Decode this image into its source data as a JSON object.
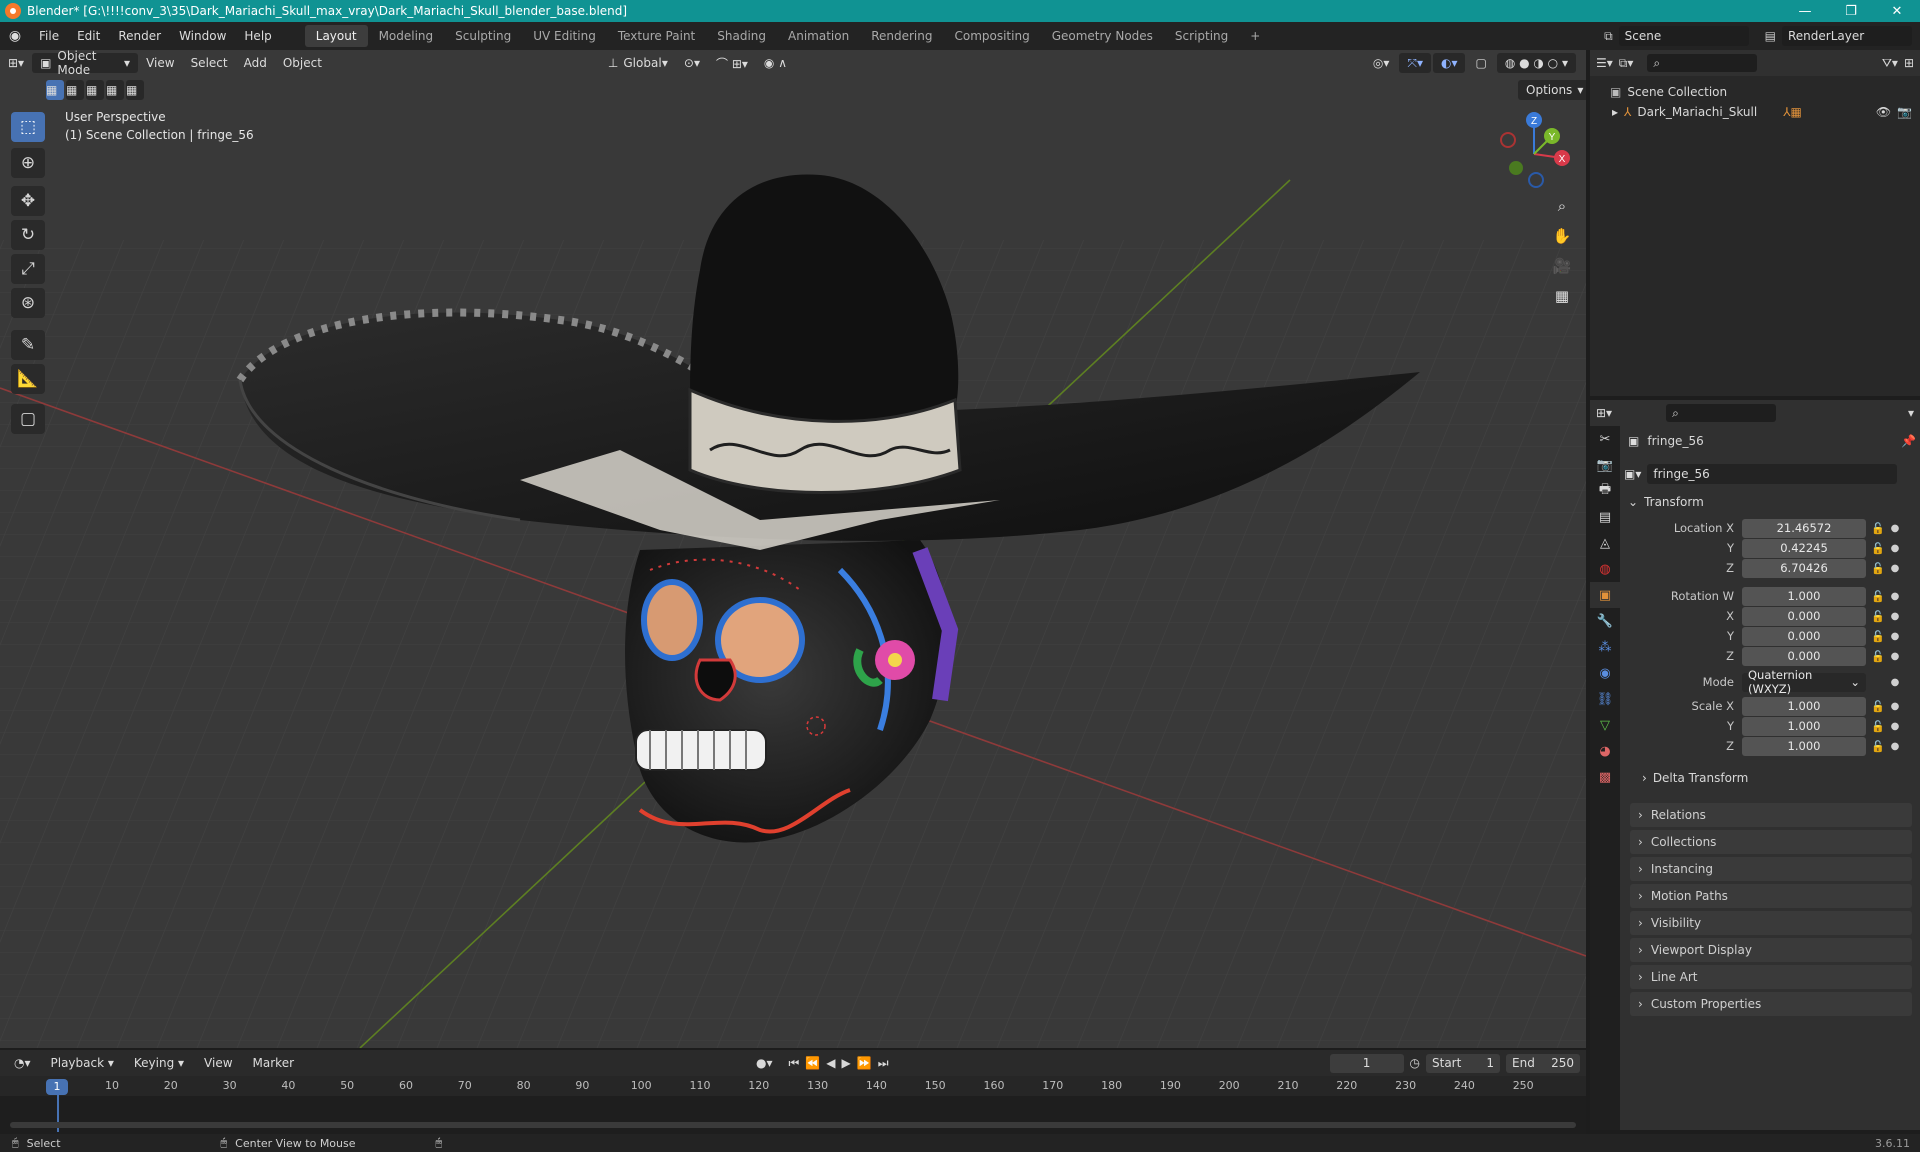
{
  "titlebar": {
    "title": "Blender* [G:\\!!!!conv_3\\35\\Dark_Mariachi_Skull_max_vray\\Dark_Mariachi_Skull_blender_base.blend]",
    "minimize": "—",
    "maximize": "❐",
    "close": "✕"
  },
  "menu": [
    "File",
    "Edit",
    "Render",
    "Window",
    "Help"
  ],
  "workspaces": [
    "Layout",
    "Modeling",
    "Sculpting",
    "UV Editing",
    "Texture Paint",
    "Shading",
    "Animation",
    "Rendering",
    "Compositing",
    "Geometry Nodes",
    "Scripting"
  ],
  "workspace_add": "+",
  "scene": {
    "name": "Scene",
    "render_layer": "RenderLayer"
  },
  "viewport": {
    "mode": "Object Mode",
    "menus": [
      "View",
      "Select",
      "Add",
      "Object"
    ],
    "orientation": "Global",
    "options": "Options",
    "perspective_label": "User Perspective",
    "collection_label": "(1) Scene Collection | fringe_56",
    "gizmo": {
      "x": "X",
      "y": "Y",
      "z": "Z"
    }
  },
  "outliner": {
    "scene_collection": "Scene Collection",
    "object": "Dark_Mariachi_Skull"
  },
  "properties": {
    "object_name": "fringe_56",
    "datablock": "fringe_56",
    "transform_header": "Transform",
    "location": {
      "label": "Location X",
      "x": "21.46572",
      "y": "0.42245",
      "z": "6.70426"
    },
    "rotation": {
      "label": "Rotation W",
      "w": "1.000",
      "x": "0.000",
      "y": "0.000",
      "z": "0.000"
    },
    "mode": {
      "label": "Mode",
      "value": "Quaternion (WXYZ)"
    },
    "scale": {
      "label": "Scale X",
      "x": "1.000",
      "y": "1.000",
      "z": "1.000"
    },
    "axis_labels": {
      "y": "Y",
      "z": "Z",
      "x": "X"
    },
    "delta": "Delta Transform",
    "panels": [
      "Relations",
      "Collections",
      "Instancing",
      "Motion Paths",
      "Visibility",
      "Viewport Display",
      "Line Art",
      "Custom Properties"
    ]
  },
  "timeline": {
    "menus": [
      "Playback",
      "Keying",
      "View",
      "Marker"
    ],
    "current_frame": "1",
    "start_label": "Start",
    "start": "1",
    "end_label": "End",
    "end": "250",
    "ticks": [
      "10",
      "20",
      "30",
      "40",
      "50",
      "60",
      "70",
      "80",
      "90",
      "100",
      "110",
      "120",
      "130",
      "140",
      "150",
      "160",
      "170",
      "180",
      "190",
      "200",
      "210",
      "220",
      "230",
      "240",
      "250"
    ],
    "playhead": "1"
  },
  "statusbar": {
    "select": "Select",
    "center": "Center View to Mouse",
    "version": "3.6.11"
  }
}
